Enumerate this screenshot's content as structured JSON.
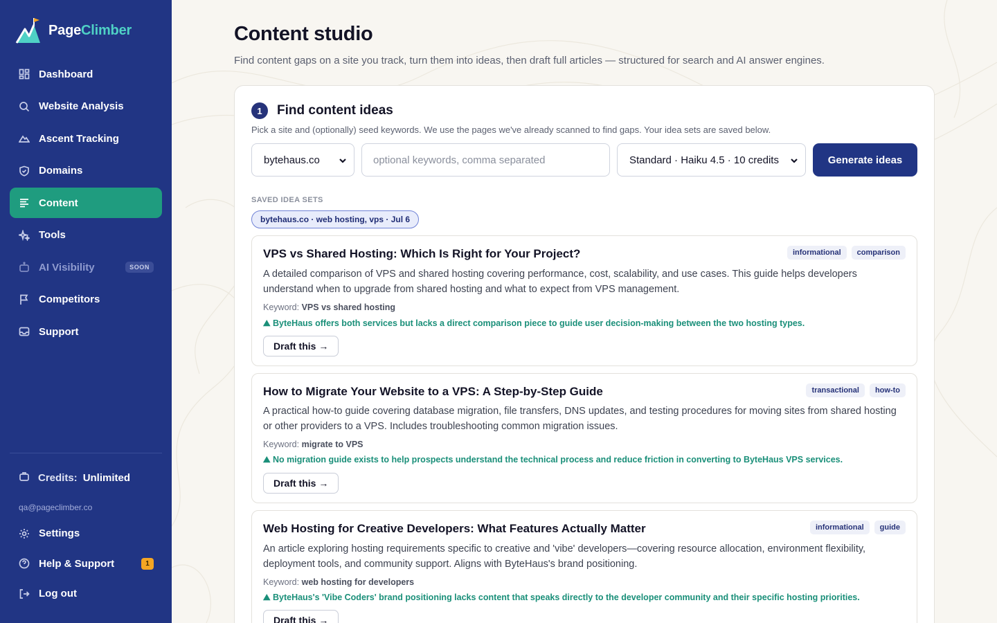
{
  "brand": {
    "name_part1": "Page",
    "name_part2": "Climber",
    "logo_icon": "mountain-logo-icon"
  },
  "sidebar": {
    "items": [
      {
        "label": "Dashboard",
        "icon": "dashboard-icon"
      },
      {
        "label": "Website Analysis",
        "icon": "search-icon"
      },
      {
        "label": "Ascent Tracking",
        "icon": "mountain-icon"
      },
      {
        "label": "Domains",
        "icon": "shield-icon"
      },
      {
        "label": "Content",
        "icon": "content-lines-icon",
        "active": true
      },
      {
        "label": "Tools",
        "icon": "sparkle-icon"
      },
      {
        "label": "AI Visibility",
        "icon": "robot-icon",
        "badge": "SOON"
      },
      {
        "label": "Competitors",
        "icon": "flag-icon"
      },
      {
        "label": "Support",
        "icon": "inbox-icon"
      }
    ],
    "credits_label": "Credits:",
    "credits_value": "Unlimited",
    "email": "qa@pageclimber.co",
    "bottom_items": [
      {
        "label": "Settings",
        "icon": "gear-icon"
      },
      {
        "label": "Help & Support",
        "icon": "help-icon",
        "badge": "1"
      },
      {
        "label": "Log out",
        "icon": "logout-icon"
      }
    ]
  },
  "page": {
    "title": "Content studio",
    "subtitle": "Find content gaps on a site you track, turn them into ideas, then draft full articles — structured for search and AI answer engines."
  },
  "step": {
    "number": "1",
    "title": "Find content ideas",
    "subtitle": "Pick a site and (optionally) seed keywords. We use the pages we've already scanned to find gaps. Your idea sets are saved below.",
    "site_value": "bytehaus.co",
    "keywords_placeholder": "optional keywords, comma separated",
    "model_value": "Standard · Haiku 4.5 · 10 credits",
    "generate_label": "Generate ideas",
    "saved_label": "SAVED IDEA SETS",
    "saved_chip": "bytehaus.co · web hosting, vps · Jul 6"
  },
  "ideas": [
    {
      "title": "VPS vs Shared Hosting: Which Is Right for Your Project?",
      "tags": [
        "informational",
        "comparison"
      ],
      "description": "A detailed comparison of VPS and shared hosting covering performance, cost, scalability, and use cases. This guide helps developers understand when to upgrade from shared hosting and what to expect from VPS management.",
      "keyword_label": "Keyword:",
      "keyword": "VPS vs shared hosting",
      "gap": "⛰ ByteHaus offers both services but lacks a direct comparison piece to guide user decision-making between the two hosting types.",
      "draft_label": "Draft this →"
    },
    {
      "title": "How to Migrate Your Website to a VPS: A Step-by-Step Guide",
      "tags": [
        "transactional",
        "how-to"
      ],
      "description": "A practical how-to guide covering database migration, file transfers, DNS updates, and testing procedures for moving sites from shared hosting or other providers to a VPS. Includes troubleshooting common migration issues.",
      "keyword_label": "Keyword:",
      "keyword": "migrate to VPS",
      "gap": "⛰ No migration guide exists to help prospects understand the technical process and reduce friction in converting to ByteHaus VPS services.",
      "draft_label": "Draft this →"
    },
    {
      "title": "Web Hosting for Creative Developers: What Features Actually Matter",
      "tags": [
        "informational",
        "guide"
      ],
      "description": "An article exploring hosting requirements specific to creative and 'vibe' developers—covering resource allocation, environment flexibility, deployment tools, and community support. Aligns with ByteHaus's brand positioning.",
      "keyword_label": "Keyword:",
      "keyword": "web hosting for developers",
      "gap": "⛰ ByteHaus's 'Vibe Coders' brand positioning lacks content that speaks directly to the developer community and their specific hosting priorities.",
      "draft_label": "Draft this →"
    }
  ],
  "colors": {
    "sidebar": "#213584",
    "active": "#1f9c7f",
    "accent_teal": "#4fd1c5",
    "gap_text": "#1a8f79",
    "badge": "#f5a623"
  }
}
